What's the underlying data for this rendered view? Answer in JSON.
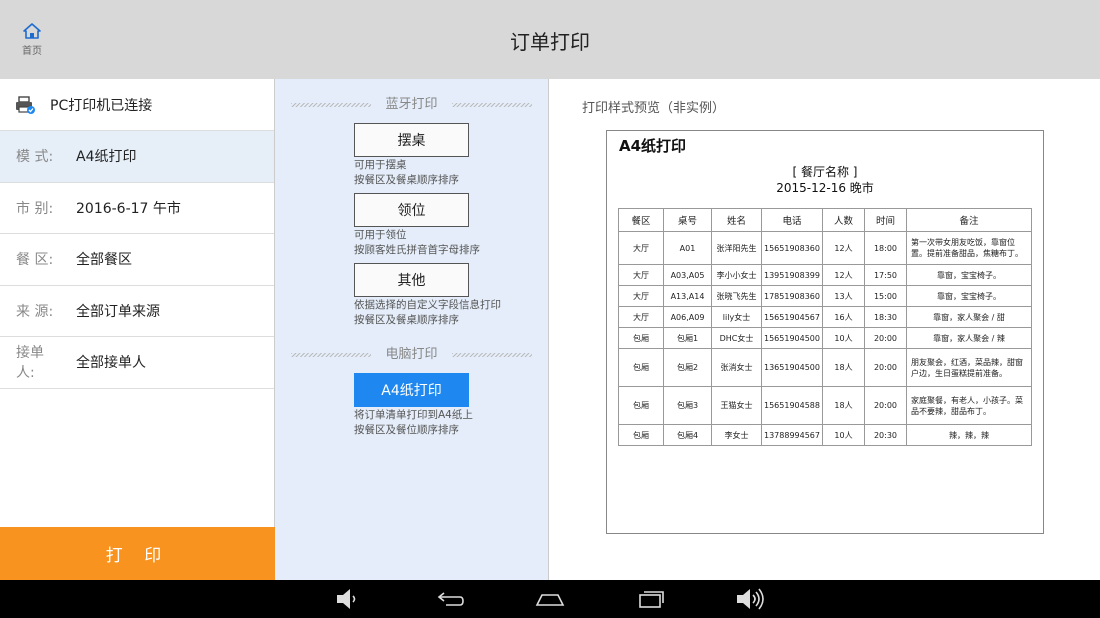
{
  "header": {
    "home_label": "首页",
    "title": "订单打印"
  },
  "left": {
    "printer_status": "PC打印机已连接",
    "filters": [
      {
        "label": "模 式:",
        "value": "A4纸打印"
      },
      {
        "label": "市 别:",
        "value": "2016-6-17 午市"
      },
      {
        "label": "餐 区:",
        "value": "全部餐区"
      },
      {
        "label": "来 源:",
        "value": "全部订单来源"
      },
      {
        "label": "接单人:",
        "value": "全部接单人"
      }
    ],
    "print_button": "打 印"
  },
  "middle": {
    "bluetooth_title": "蓝牙打印",
    "pc_title": "电脑打印",
    "options": [
      {
        "label": "摆桌",
        "desc1": "可用于摆桌",
        "desc2": "按餐区及餐桌顺序排序"
      },
      {
        "label": "领位",
        "desc1": "可用于领位",
        "desc2": "按顾客姓氏拼音首字母排序"
      },
      {
        "label": "其他",
        "desc1": "依据选择的自定义字段信息打印",
        "desc2": "按餐区及餐桌顺序排序"
      },
      {
        "label": "A4纸打印",
        "desc1": "将订单清单打印到A4纸上",
        "desc2": "按餐区及餐位顺序排序"
      }
    ]
  },
  "right": {
    "preview_title": "打印样式预览（非实例）",
    "paper_head": "A4纸打印",
    "restaurant": "[ 餐厅名称 ]",
    "date_line": "2015-12-16   晚市",
    "columns": [
      "餐区",
      "桌号",
      "姓名",
      "电话",
      "人数",
      "时间",
      "备注"
    ],
    "rows": [
      [
        "大厅",
        "A01",
        "张洋阳先生",
        "15651908360",
        "12人",
        "18:00",
        "第一次带女朋友吃饭，靠窗位置。提前准备甜品，焦糖布丁。"
      ],
      [
        "大厅",
        "A03,A05",
        "李小小女士",
        "13951908399",
        "12人",
        "17:50",
        "靠窗，宝宝椅子。"
      ],
      [
        "大厅",
        "A13,A14",
        "张晓飞先生",
        "17851908360",
        "13人",
        "15:00",
        "靠窗，宝宝椅子。"
      ],
      [
        "大厅",
        "A06,A09",
        "lily女士",
        "15651904567",
        "16人",
        "18:30",
        "靠窗，家人聚会 / 甜"
      ],
      [
        "包厢",
        "包厢1",
        "DHC女士",
        "15651904500",
        "10人",
        "20:00",
        "靠窗，家人聚会 / 辣"
      ],
      [
        "包厢",
        "包厢2",
        "张消女士",
        "13651904500",
        "18人",
        "20:00",
        "朋友聚会，红酒，菜品辣，甜窗户边，生日蛋糕提前准备。"
      ],
      [
        "包厢",
        "包厢3",
        "王猫女士",
        "15651904588",
        "18人",
        "20:00",
        "家庭聚餐，有老人，小孩子。菜品不要辣，甜品布丁。"
      ],
      [
        "包厢",
        "包厢4",
        "李女士",
        "13788994567",
        "10人",
        "20:30",
        "辣，辣，辣"
      ]
    ]
  },
  "icons": {
    "home": "home-icon",
    "printer": "printer-icon",
    "vol_down": "volume-down-icon",
    "back": "back-icon",
    "home_nav": "home-nav-icon",
    "recents": "recents-icon",
    "vol_up": "volume-up-icon"
  },
  "colors": {
    "accent": "#f7931e",
    "selected": "#1e88f0"
  }
}
